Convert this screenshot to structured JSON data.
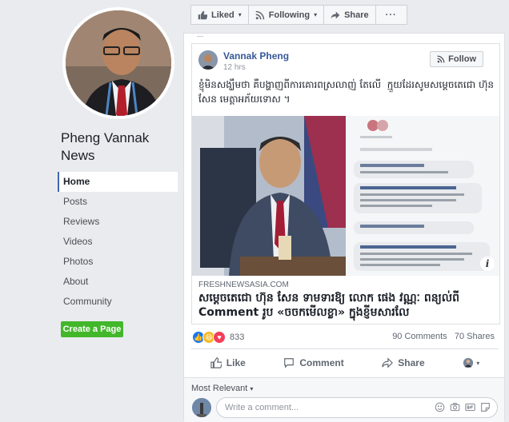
{
  "page": {
    "name": "Pheng Vannak News",
    "nav": [
      "Home",
      "Posts",
      "Reviews",
      "Videos",
      "Photos",
      "About",
      "Community"
    ],
    "create_page_label": "Create a Page"
  },
  "actionbar": {
    "liked_label": "Liked",
    "following_label": "Following",
    "share_label": "Share",
    "more_label": "···"
  },
  "post": {
    "author": "Vannak Pheng",
    "time": "12 hrs",
    "follow_label": "Follow",
    "text": "ខ្ញុំមិន​សង្ឃឹមថា​ ​គឺបង្ហាញពីការគោរព​ស្រលាញ់​​ តែលើ​ ​ ​ក្មួយ​ដែរ​សូម​សម្ដេចតេជោ​ ហ៊ុន​ ​សែន​ មេត្តាអភ័យទោស​ ។",
    "link_domain": "FRESHNEWSASIA.COM",
    "link_title": "សម្ដេចតេជោ ហ៊ុន សែន ទាមទារឱ្យ លោក ផេង វណ្ណៈ ពន្យល់ពី Comment រូប «ចចកមើលខ្លា» ក្នុងខ្ញីមសារលែ",
    "info_icon": "i"
  },
  "stats": {
    "reaction_count": "833",
    "comments": "90 Comments",
    "shares": "70 Shares"
  },
  "actions": {
    "like": "Like",
    "comment": "Comment",
    "share": "Share"
  },
  "comments": {
    "sort_label": "Most Relevant",
    "placeholder": "Write a comment..."
  },
  "colors": {
    "facebook_blue": "#4267b2",
    "create_page_green": "#42b72a",
    "like_reaction": "#1877f2",
    "haha_reaction": "#f7b928",
    "love_reaction": "#f33e58"
  },
  "icons": [
    "like-icon",
    "rss-icon",
    "share-icon",
    "comment-icon",
    "camera-icon",
    "gif-icon",
    "sticker-icon",
    "emoji-icon",
    "info-icon"
  ]
}
